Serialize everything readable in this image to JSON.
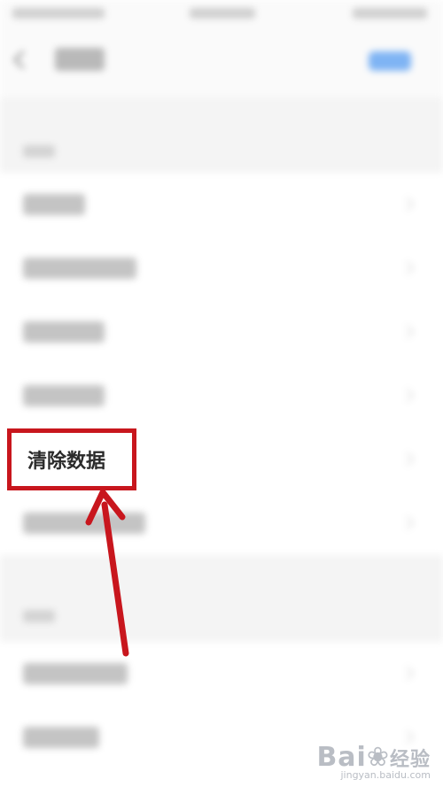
{
  "highlight": {
    "label": "清除数据"
  },
  "watermark": {
    "brand": "Bai",
    "suffix": "经验",
    "url": "jingyan.baidu.com"
  },
  "icons": {
    "back": "back-arrow-icon",
    "row_chevron": "chevron-right-icon",
    "pointer": "red-arrow-annotation-icon",
    "watermark_paw": "baidu-paw-icon"
  },
  "colors": {
    "annotation_red": "#c8161d",
    "action_blue": "#7fb4f4",
    "watermark_gray": "#b9bdc4"
  }
}
